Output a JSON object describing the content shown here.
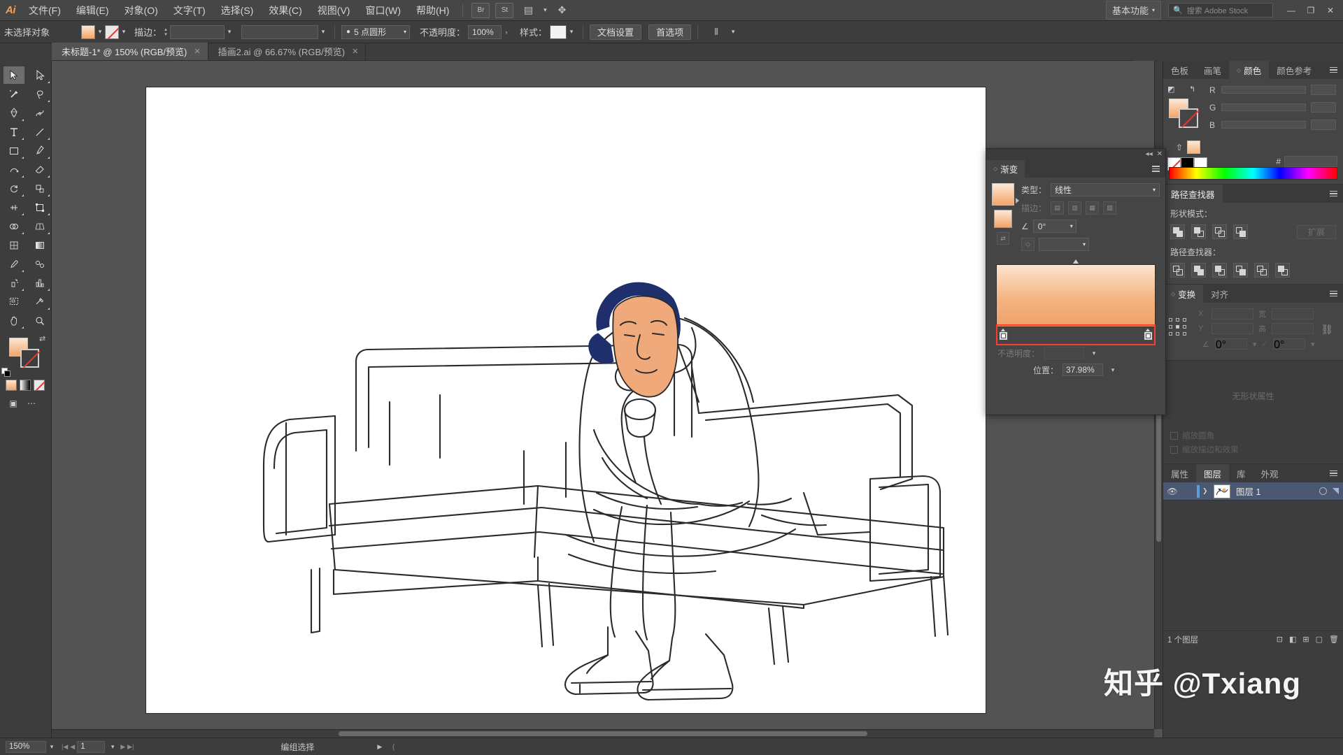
{
  "app": {
    "logo": "Ai",
    "workspace": "基本功能",
    "search_placeholder": "搜索 Adobe Stock"
  },
  "menubar": {
    "items": [
      {
        "label": "文件(F)"
      },
      {
        "label": "编辑(E)"
      },
      {
        "label": "对象(O)"
      },
      {
        "label": "文字(T)"
      },
      {
        "label": "选择(S)"
      },
      {
        "label": "效果(C)"
      },
      {
        "label": "视图(V)"
      },
      {
        "label": "窗口(W)"
      },
      {
        "label": "帮助(H)"
      }
    ],
    "icons": [
      {
        "name": "bridge-icon",
        "glyph": "Br"
      },
      {
        "name": "stock-icon",
        "glyph": "St"
      },
      {
        "name": "arrange-documents-icon",
        "glyph": "▤"
      },
      {
        "name": "touch-workspace-icon",
        "glyph": "✥"
      }
    ],
    "window_buttons": [
      {
        "name": "minimize-button",
        "glyph": "—"
      },
      {
        "name": "maximize-button",
        "glyph": "❐"
      },
      {
        "name": "close-button",
        "glyph": "✕"
      }
    ]
  },
  "controlbar": {
    "selection_status": "未选择对象",
    "fill_swatch_title": "填色",
    "stroke_swatch_title": "描边",
    "stroke_label": "描边：",
    "stroke_weight_value": "",
    "stroke_profile_value": "",
    "brush_definition_value": "",
    "opacity_label": "不透明度：",
    "opacity_value": "100%",
    "style_label": "样式：",
    "stroke_style_value": "5 点圆形",
    "document_setup_button": "文档设置",
    "preferences_button": "首选项",
    "align_icon": "align-icon"
  },
  "tabs": [
    {
      "label": "未标题-1* @ 150% (RGB/预览)",
      "active": true,
      "close": "✕"
    },
    {
      "label": "插画2.ai @ 66.67% (RGB/预览)",
      "active": false,
      "close": "✕"
    }
  ],
  "toolbar": {
    "tools": [
      {
        "name": "selection-tool",
        "selected": true
      },
      {
        "name": "direct-selection-tool",
        "selected": false
      },
      {
        "name": "magic-wand-tool",
        "selected": false
      },
      {
        "name": "lasso-tool",
        "selected": false
      },
      {
        "name": "pen-tool",
        "selected": false
      },
      {
        "name": "curvature-tool",
        "selected": false
      },
      {
        "name": "type-tool",
        "selected": false
      },
      {
        "name": "line-segment-tool",
        "selected": false
      },
      {
        "name": "rectangle-tool",
        "selected": false
      },
      {
        "name": "paintbrush-tool",
        "selected": false
      },
      {
        "name": "shaper-tool",
        "selected": false
      },
      {
        "name": "eraser-tool",
        "selected": false
      },
      {
        "name": "rotate-tool",
        "selected": false
      },
      {
        "name": "scale-tool",
        "selected": false
      },
      {
        "name": "width-tool",
        "selected": false
      },
      {
        "name": "free-transform-tool",
        "selected": false
      },
      {
        "name": "shape-builder-tool",
        "selected": false
      },
      {
        "name": "perspective-grid-tool",
        "selected": false
      },
      {
        "name": "mesh-tool",
        "selected": false
      },
      {
        "name": "gradient-tool",
        "selected": false
      },
      {
        "name": "eyedropper-tool",
        "selected": false
      },
      {
        "name": "blend-tool",
        "selected": false
      },
      {
        "name": "symbol-sprayer-tool",
        "selected": false
      },
      {
        "name": "column-graph-tool",
        "selected": false
      },
      {
        "name": "artboard-tool",
        "selected": false
      },
      {
        "name": "slice-tool",
        "selected": false
      },
      {
        "name": "hand-tool",
        "selected": false
      },
      {
        "name": "zoom-tool",
        "selected": false
      }
    ],
    "fill_color": "#f2a469",
    "stroke_color": "none",
    "color_modes": [
      "color-mode",
      "gradient-mode",
      "none-mode"
    ],
    "bottom_icons": [
      "change-screen-mode-icon",
      "edit-toolbar-icon"
    ]
  },
  "canvas": {
    "zoom": "150%",
    "artboard_background": "#ffffff",
    "artwork_description": "线稿插画：一个人坐在沙发上手托下巴思考",
    "hair_color": "#1f2f6b",
    "skin_color": "#f0a97b",
    "line_color": "#2a2a2a"
  },
  "panels": {
    "color_group": {
      "tabs": [
        {
          "label": "色板",
          "active": false
        },
        {
          "label": "画笔",
          "active": false
        },
        {
          "label": "颜色",
          "active": true
        },
        {
          "label": "颜色参考",
          "active": false
        }
      ],
      "sliders": [
        {
          "label": "R",
          "value": ""
        },
        {
          "label": "G",
          "value": ""
        },
        {
          "label": "B",
          "value": ""
        }
      ],
      "hex_label": "#",
      "hex_value": ""
    },
    "pathfinder": {
      "tabs": [
        {
          "label": "路径查找器",
          "active": true
        }
      ],
      "shape_modes_label": "形状模式：",
      "pathfinders_label": "路径查找器：",
      "expand_button": "扩展",
      "shape_mode_buttons": [
        "unite-icon",
        "minus-front-icon",
        "intersect-icon",
        "exclude-icon"
      ],
      "pathfinder_buttons": [
        "divide-icon",
        "trim-icon",
        "merge-icon",
        "crop-icon",
        "outline-icon",
        "minus-back-icon"
      ]
    },
    "transform": {
      "tabs": [
        {
          "label": "变换",
          "active": true
        },
        {
          "label": "对齐",
          "active": false
        }
      ],
      "fields": [
        {
          "label": "X",
          "value": ""
        },
        {
          "label": "宽",
          "value": ""
        },
        {
          "label": "Y",
          "value": ""
        },
        {
          "label": "高",
          "value": ""
        }
      ],
      "angle_label": "∠",
      "angle_value": "0°",
      "shear_value": "0°",
      "link_icon": "constrain-proportions-icon"
    },
    "properties_group": {
      "tabs": [
        {
          "label": "属性",
          "active": false
        },
        {
          "label": "图层",
          "active": true
        },
        {
          "label": "库",
          "active": false
        },
        {
          "label": "外观",
          "active": false
        }
      ],
      "layers": [
        {
          "name": "图层 1",
          "visible": true,
          "locked": false,
          "selected": true
        }
      ],
      "footer_count": "1 个图层",
      "footer_icons": [
        "locate-object-icon",
        "make-mask-icon",
        "new-sublayer-icon",
        "new-layer-icon",
        "delete-layer-icon"
      ]
    },
    "no_shape_placeholder": "无形状属性",
    "dim_labels": [
      "缩放圆角",
      "缩放描边和效果"
    ]
  },
  "gradient_panel": {
    "tab_label": "渐变",
    "type_label": "类型：",
    "type_value": "线性",
    "stroke_label": "描边：",
    "angle_label": "∠",
    "angle_value": "0°",
    "opacity_label": "不透明度：",
    "position_label": "位置：",
    "position_value": "37.98%",
    "stops": [
      {
        "position": 0,
        "color": "#fbe4cf"
      },
      {
        "position": 100,
        "color": "#f0a06a"
      }
    ],
    "midpoint": 50,
    "highlight_color": "#ff3b30",
    "close_glyph": "✕",
    "collapse_glyph": "◂◂"
  },
  "statusbar": {
    "zoom_value": "150%",
    "page_value": "1",
    "status_text": "编组选择",
    "nav_first": "|◀",
    "nav_prev": "◀",
    "nav_next": "▶",
    "nav_last": "▶|"
  },
  "watermark": "知乎 @Txiang"
}
